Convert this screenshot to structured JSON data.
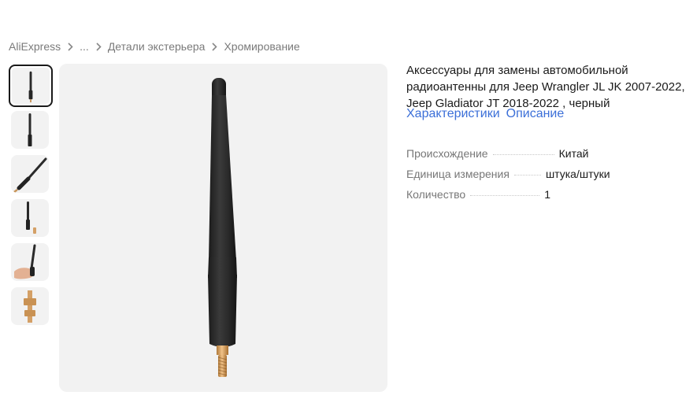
{
  "breadcrumb": {
    "items": [
      "AliExpress",
      "...",
      "Детали экстерьера",
      "Хромирование"
    ]
  },
  "thumbnails": [
    {
      "depicts": "antenna-front",
      "active": true
    },
    {
      "depicts": "antenna-dark"
    },
    {
      "depicts": "antenna-diagonal"
    },
    {
      "depicts": "antenna-with-adapter"
    },
    {
      "depicts": "antenna-in-hand"
    },
    {
      "depicts": "brass-adapter"
    }
  ],
  "product": {
    "title": "Аксессуары для замены автомобильной радиоантенны для Jeep Wrangler JL JK 2007-2022, Jeep Gladiator JT 2018-2022 , черный"
  },
  "tabs": [
    "Характеристики",
    "Описание"
  ],
  "specs": [
    {
      "key": "Происхождение",
      "value": "Китай"
    },
    {
      "key": "Единица измерения",
      "value": "штука/штуки"
    },
    {
      "key": "Количество",
      "value": "1"
    }
  ],
  "colors": {
    "link": "#3b6fd8",
    "thumb_active_border": "#1a1a1a",
    "image_bg": "#f2f2f2"
  }
}
